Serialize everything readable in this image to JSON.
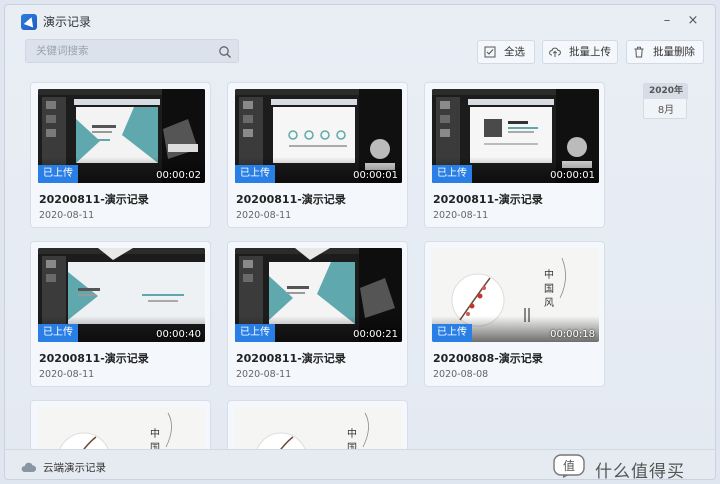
{
  "app": {
    "title": "演示记录",
    "minimize_glyph": "–",
    "close_glyph": "×"
  },
  "search": {
    "placeholder": "关键词搜索",
    "value": ""
  },
  "toolbar": {
    "select_all": "全选",
    "bulk_upload": "批量上传",
    "bulk_delete": "批量删除"
  },
  "date_marker": {
    "year": "2020年",
    "month": "8月"
  },
  "records": [
    {
      "title": "20200811-演示记录",
      "date": "2020-08-11",
      "badge": "已上传",
      "duration": "00:00:02",
      "thumb": "slides-a"
    },
    {
      "title": "20200811-演示记录",
      "date": "2020-08-11",
      "badge": "已上传",
      "duration": "00:00:01",
      "thumb": "slides-b"
    },
    {
      "title": "20200811-演示记录",
      "date": "2020-08-11",
      "badge": "已上传",
      "duration": "00:00:01",
      "thumb": "slides-c"
    },
    {
      "title": "20200811-演示记录",
      "date": "2020-08-11",
      "badge": "已上传",
      "duration": "00:00:40",
      "thumb": "slides-d"
    },
    {
      "title": "20200811-演示记录",
      "date": "2020-08-11",
      "badge": "已上传",
      "duration": "00:00:21",
      "thumb": "slides-e"
    },
    {
      "title": "20200808-演示记录",
      "date": "2020-08-08",
      "badge": "已上传",
      "duration": "00:00:18",
      "thumb": "chinese-style"
    },
    {
      "thumb": "chinese-style"
    },
    {
      "thumb": "chinese-style"
    }
  ],
  "thumb_text": {
    "chinese": "中国风"
  },
  "statusbar": {
    "label": "云端演示记录"
  },
  "watermark": {
    "logo_text": "值",
    "text": "什么值得买"
  },
  "colors": {
    "accent": "#2a7fe6",
    "teal": "#5fa8ad"
  }
}
